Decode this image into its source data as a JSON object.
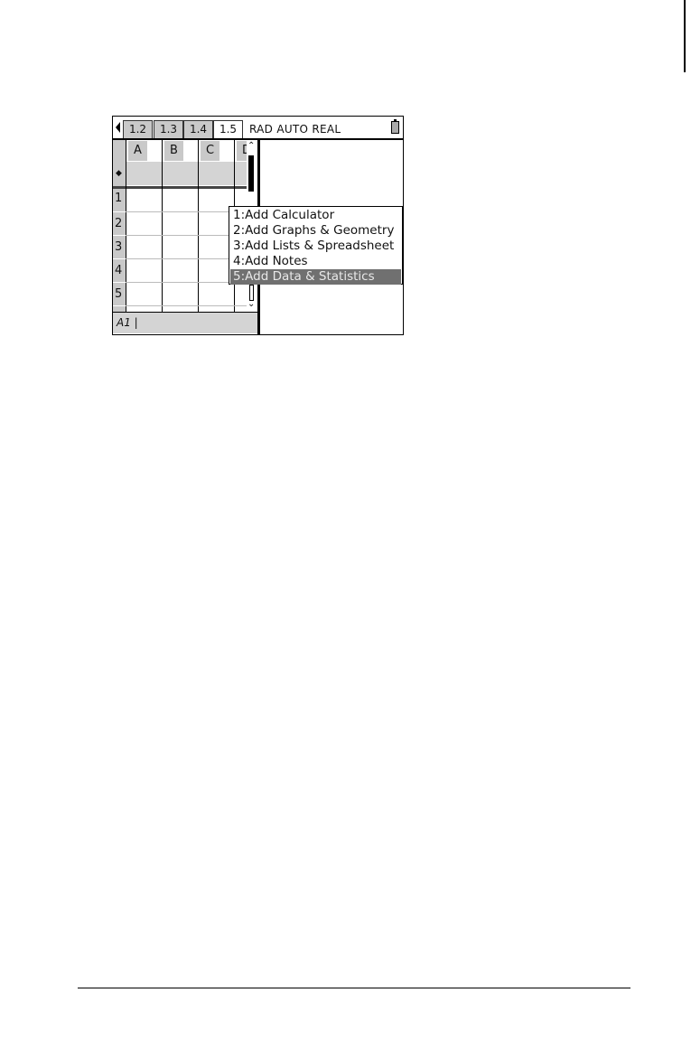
{
  "tabs": [
    "1.2",
    "1.3",
    "1.4",
    "1.5"
  ],
  "active_tab": "1.5",
  "status": "RAD AUTO REAL",
  "spreadsheet": {
    "columns": [
      "A",
      "B",
      "C",
      "D"
    ],
    "formula_row_marker": "◆",
    "rows": [
      "1",
      "2",
      "3",
      "4",
      "5"
    ],
    "entry_bar": "A1 |"
  },
  "menu": {
    "items": [
      "1:Add Calculator",
      "2:Add Graphs & Geometry",
      "3:Add Lists & Spreadsheet",
      "4:Add Notes",
      "5:Add Data & Statistics"
    ],
    "selected_index": 4
  },
  "icons": {
    "left_arrow": "left-arrow-icon",
    "battery": "battery-icon",
    "scroll_up": "scroll-up-icon",
    "scroll_down": "scroll-down-icon"
  }
}
